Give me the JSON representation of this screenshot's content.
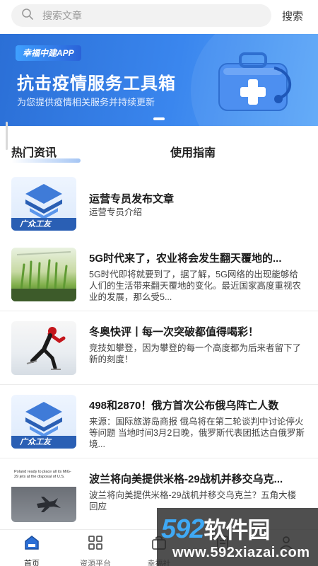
{
  "search": {
    "placeholder": "搜索文章",
    "button_label": "搜索"
  },
  "banner": {
    "app_badge": "幸福中建APP",
    "title": "抗击疫情服务工具箱",
    "subtitle": "为您提供疫情相关服务并持续更新"
  },
  "tabs": [
    {
      "label": "热门资讯",
      "active": true
    },
    {
      "label": "使用指南",
      "active": false
    }
  ],
  "articles": [
    {
      "title": "运营专员发布文章",
      "desc": "运营专员介绍",
      "thumb": "logo",
      "thumb_text": "广众工友"
    },
    {
      "title": "5G时代来了，农业将会发生翻天覆地的...",
      "desc": "5G时代即将就要到了，据了解，5G网络的出现能够给人们的生活带来翻天覆地的变化。最近国家高度重视农业的发展，那么受5...",
      "thumb": "farm"
    },
    {
      "title": "冬奥快评丨每一次突破都值得喝彩！",
      "desc": "竞技如攀登，因为攀登的每一个高度都为后来者留下了新的刻度！",
      "thumb": "skater"
    },
    {
      "title": "498和2870！俄方首次公布俄乌阵亡人数",
      "desc": "来源：国际旅游岛商报 俄乌将在第二轮谈判中讨论停火等问题 当地时间3月2日晚，俄罗斯代表团抵达白俄罗斯境...",
      "thumb": "logo",
      "thumb_text": "广众工友"
    },
    {
      "title": "波兰将向美提供米格-29战机并移交乌克...",
      "desc": "波兰将向美提供米格-29战机并移交乌克兰？五角大楼回应",
      "thumb": "jet",
      "thumb_caption": "Poland ready to place all its MiG-29 jets at the disposal of U.S."
    }
  ],
  "bottom_nav": [
    {
      "label": "首页",
      "icon": "home-icon",
      "active": true
    },
    {
      "label": "资源平台",
      "icon": "grid-icon",
      "active": false
    },
    {
      "label": "幸福社",
      "icon": "bag-icon",
      "active": false
    },
    {
      "label": "",
      "icon": "doc-icon",
      "active": false
    },
    {
      "label": "",
      "icon": "user-icon",
      "active": false
    }
  ],
  "watermark": {
    "logo_num": "592",
    "logo_cn": "软件园",
    "url": "www.592xiazai.com"
  },
  "colors": {
    "accent": "#3a86ee",
    "banner_dark": "#2b6fd6",
    "logo_blue": "#2a5fb4"
  }
}
